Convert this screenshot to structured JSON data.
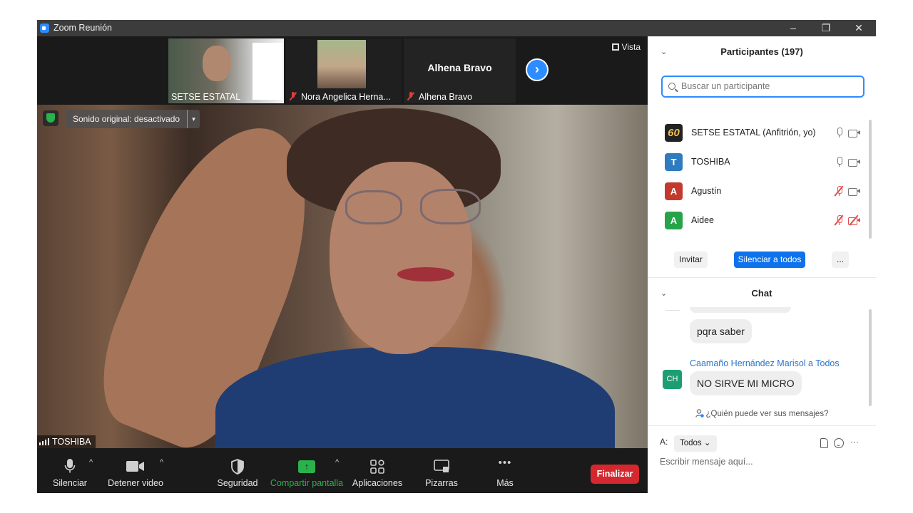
{
  "window": {
    "title": "Zoom Reunión",
    "controls": {
      "minimize": "–",
      "restore": "❐",
      "close": "✕"
    }
  },
  "strip": {
    "thumbs": [
      {
        "label": "SETSE ESTATAL",
        "muted": false
      },
      {
        "label": "Nora Angelica Herna...",
        "muted": true
      },
      {
        "name_big": "Alhena Bravo",
        "label": "Alhena Bravo",
        "muted": true
      }
    ],
    "view_label": "Vista",
    "next_arrow": "›"
  },
  "video": {
    "audio_pill": "Sonido original: desactivado",
    "audio_caret": "▾",
    "speaker_name": "TOSHIBA"
  },
  "toolbar": {
    "mute": "Silenciar",
    "stop_video": "Detener video",
    "security": "Seguridad",
    "share": "Compartir pantalla",
    "apps": "Aplicaciones",
    "whiteboards": "Pizarras",
    "more": "Más",
    "more_dots": "•••",
    "end": "Finalizar",
    "caret": "^",
    "share_arrow": "↑",
    "colors": {
      "share_green": "#2bb24c",
      "end_red": "#d5282e"
    }
  },
  "participants": {
    "title": "Participantes (197)",
    "search_placeholder": "Buscar un participante",
    "list": [
      {
        "initial": "60",
        "name": "SETSE ESTATAL (Anfitrión, yo)",
        "color": "#222222",
        "mic_off": false,
        "cam_off": false
      },
      {
        "initial": "T",
        "name": "TOSHIBA",
        "color": "#2e7bbf",
        "mic_off": false,
        "cam_off": false
      },
      {
        "initial": "A",
        "name": "Agustín",
        "color": "#c33a2c",
        "mic_off": true,
        "cam_off": false
      },
      {
        "initial": "A",
        "name": "Aidee",
        "color": "#27a34a",
        "mic_off": true,
        "cam_off": true
      }
    ],
    "invite": "Invitar",
    "mute_all": "Silenciar a todos",
    "more": "..."
  },
  "chat": {
    "title": "Chat",
    "messages": [
      {
        "text": "pqra saber"
      },
      {
        "sender": "Caamaño Hernández Marisol a Todos",
        "initials": "CH",
        "text": "NO SIRVE MI MICRO"
      }
    ],
    "who_sees": "¿Quién puede ver sus mensajes?",
    "to_label": "A:",
    "recipient": "Todos",
    "input_placeholder": "Escribir mensaje aquí...",
    "more": "···",
    "chevron": "⌄"
  },
  "accent_blue": "#2d8cff"
}
